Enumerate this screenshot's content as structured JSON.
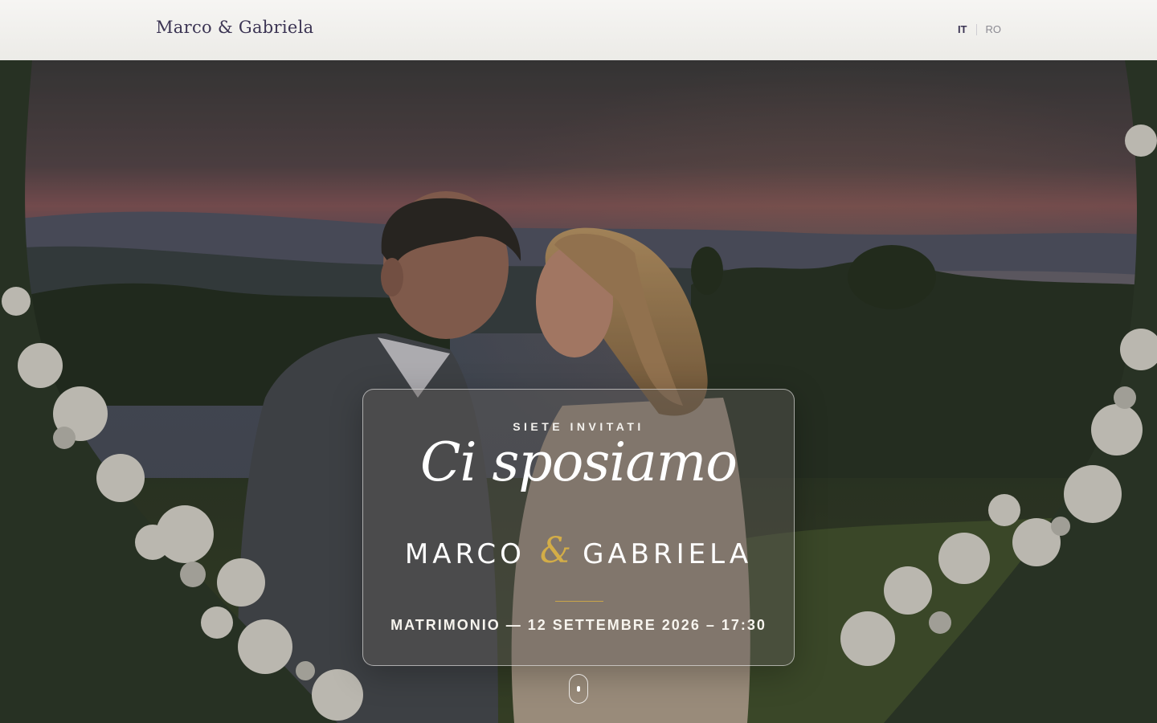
{
  "header": {
    "brand": "Marco & Gabriela",
    "languages": [
      {
        "label": "IT",
        "active": true
      },
      {
        "label": "RO",
        "active": false
      }
    ]
  },
  "hero": {
    "kicker": "SIETE INVITATI",
    "title": "Ci sposiamo",
    "name_left": "MARCO",
    "ampersand": "&",
    "name_right": "GABRIELA",
    "details": "MATRIMONIO — 12 SETTEMBRE 2026 – 17:30"
  },
  "colors": {
    "brand_text": "#3b3453",
    "accent_gold": "#d3ad47",
    "header_bg": "#f6f5f3"
  },
  "icons": {
    "scroll": "mouse-scroll-icon"
  }
}
